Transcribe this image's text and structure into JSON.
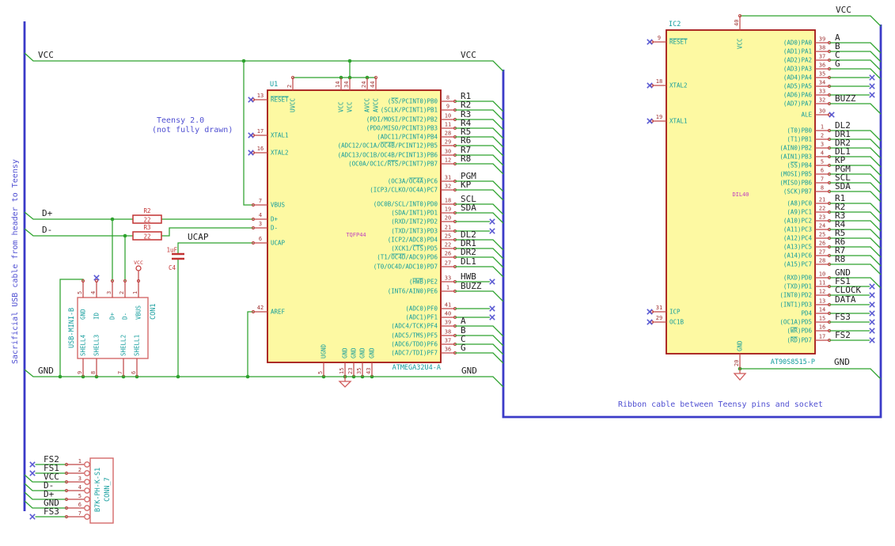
{
  "notes": {
    "sacrificial": "Sacrificial USB cable from header to Teensy",
    "teensy_line1": "Teensy 2.0",
    "teensy_line2": "(not fully drawn)",
    "ribbon": "Ribbon cable between Teensy pins and socket"
  },
  "net_labels": {
    "vcc_top_left": "VCC",
    "vcc_mid": "VCC",
    "vcc_right": "VCC",
    "gnd_left": "GND",
    "gnd_mid": "GND",
    "gnd_right": "GND",
    "dplus": "D+",
    "dminus": "D-",
    "ucap": "UCAP"
  },
  "u1": {
    "ref": "U1",
    "value": "ATMEGA32U4-A",
    "footprint": "TQFP44",
    "left_pins": [
      {
        "num": "13",
        "name": "~RESET~",
        "nc": true
      },
      {
        "num": "17",
        "name": "XTAL1",
        "nc": true
      },
      {
        "num": "16",
        "name": "XTAL2",
        "nc": true
      },
      {
        "num": "7",
        "name": "VBUS"
      },
      {
        "num": "4",
        "name": "D+"
      },
      {
        "num": "3",
        "name": "D-"
      },
      {
        "num": "6",
        "name": "UCAP"
      },
      {
        "num": "42",
        "name": "AREF"
      }
    ],
    "top_pins": [
      {
        "num": "2",
        "name": "UVCC"
      },
      {
        "num": "14",
        "name": "VCC"
      },
      {
        "num": "34",
        "name": "VCC"
      },
      {
        "num": "24",
        "name": "AVCC"
      },
      {
        "num": "44",
        "name": "AVCC"
      }
    ],
    "bottom_pins": [
      {
        "num": "5",
        "name": "UGND"
      },
      {
        "num": "15",
        "name": "GND"
      },
      {
        "num": "23",
        "name": "GND"
      },
      {
        "num": "35",
        "name": "GND"
      },
      {
        "num": "43",
        "name": "GND"
      }
    ],
    "right_pins": [
      {
        "num": "8",
        "name": "(~SS~/PCINT0)PB0",
        "label": "R1",
        "route": "bus"
      },
      {
        "num": "9",
        "name": "(SCLK/PCINT1)PB1",
        "label": "R2",
        "route": "bus"
      },
      {
        "num": "10",
        "name": "(PDI/MOSI/PCINT2)PB2",
        "label": "R3",
        "route": "bus"
      },
      {
        "num": "11",
        "name": "(PDO/MISO/PCINT3)PB3",
        "label": "R4",
        "route": "bus"
      },
      {
        "num": "28",
        "name": "(ADC11/PCINT4)PB4",
        "label": "R5",
        "route": "bus"
      },
      {
        "num": "29",
        "name": "(ADC12/OC1A/~OC4B~/PCINT12)PB5",
        "label": "R6",
        "route": "bus"
      },
      {
        "num": "30",
        "name": "(ADC13/OC1B/OC4B/PCINT13)PB6",
        "label": "R7",
        "route": "bus"
      },
      {
        "num": "12",
        "name": "(OC0A/OC1C/~RTS~/PCINT7)PB7",
        "label": "R8",
        "route": "bus"
      },
      {
        "num": "31",
        "name": "(OC3A/~OC4A~)PC6",
        "label": "PGM",
        "route": "bus"
      },
      {
        "num": "32",
        "name": "(ICP3/CLKO/OC4A)PC7",
        "label": "KP",
        "route": "bus"
      },
      {
        "num": "18",
        "name": "(OC0B/SCL/INT0)PD0",
        "label": "SCL",
        "route": "bus"
      },
      {
        "num": "19",
        "name": "(SDA/INT1)PD1",
        "label": "SDA",
        "route": "bus"
      },
      {
        "num": "20",
        "name": "(RXD/INT2)PD2",
        "label": "",
        "route": "nc"
      },
      {
        "num": "21",
        "name": "(TXD/INT3)PD3",
        "label": "",
        "route": "nc"
      },
      {
        "num": "25",
        "name": "(ICP2/ADC8)PD4",
        "label": "DL2",
        "route": "bus"
      },
      {
        "num": "22",
        "name": "(XCK1/~CTS~)PD5",
        "label": "DR1",
        "route": "bus"
      },
      {
        "num": "26",
        "name": "(T1/~OC4D~/ADC9)PD6",
        "label": "DR2",
        "route": "bus"
      },
      {
        "num": "27",
        "name": "(T0/OC4D/ADC10)PD7",
        "label": "DL1",
        "route": "bus"
      },
      {
        "num": "33",
        "name": "(~HWB~)PE2",
        "label": "HWB",
        "route": "nc"
      },
      {
        "num": "1",
        "name": "(INT6/AIN0)PE6",
        "label": "BUZZ",
        "route": "bus"
      },
      {
        "num": "41",
        "name": "(ADC0)PF0",
        "label": "",
        "route": "nc"
      },
      {
        "num": "40",
        "name": "(ADC1)PF1",
        "label": "",
        "route": "nc"
      },
      {
        "num": "39",
        "name": "(ADC4/TCK)PF4",
        "label": "A",
        "route": "bus"
      },
      {
        "num": "38",
        "name": "(ADC5/TMS)PF5",
        "label": "B",
        "route": "bus"
      },
      {
        "num": "37",
        "name": "(ADC6/TDO)PF6",
        "label": "C",
        "route": "bus"
      },
      {
        "num": "36",
        "name": "(ADC7/TDI)PF7",
        "label": "G",
        "route": "bus"
      }
    ]
  },
  "ic2": {
    "ref": "IC2",
    "value": "AT90S8515-P",
    "footprint": "DIL40",
    "left_pins": [
      {
        "num": "9",
        "name": "~RESET~",
        "nc": true
      },
      {
        "num": "18",
        "name": "XTAL2",
        "nc": true
      },
      {
        "num": "19",
        "name": "XTAL1",
        "nc": true
      },
      {
        "num": "31",
        "name": "ICP",
        "nc": true
      },
      {
        "num": "29",
        "name": "OC1B",
        "nc": true
      }
    ],
    "top_pins": [
      {
        "num": "40",
        "name": "VCC"
      }
    ],
    "bottom_pins": [
      {
        "num": "20",
        "name": "GND"
      }
    ],
    "right_pins": [
      {
        "num": "39",
        "name": "(AD0)PA0",
        "label": "A",
        "route": "bus"
      },
      {
        "num": "38",
        "name": "(AD1)PA1",
        "label": "B",
        "route": "bus"
      },
      {
        "num": "37",
        "name": "(AD2)PA2",
        "label": "C",
        "route": "bus"
      },
      {
        "num": "36",
        "name": "(AD3)PA3",
        "label": "G",
        "route": "bus"
      },
      {
        "num": "35",
        "name": "(AD4)PA4",
        "label": "",
        "route": "nc"
      },
      {
        "num": "34",
        "name": "(AD5)PA5",
        "label": "",
        "route": "nc"
      },
      {
        "num": "33",
        "name": "(AD6)PA6",
        "label": "",
        "route": "nc"
      },
      {
        "num": "32",
        "name": "(AD7)PA7",
        "label": "BUZZ",
        "route": "bus"
      },
      {
        "num": "30",
        "name": "ALE",
        "label": "",
        "route": "stub_nc"
      },
      {
        "num": "1",
        "name": "(T0)PB0",
        "label": "DL2",
        "route": "bus"
      },
      {
        "num": "2",
        "name": "(T1)PB1",
        "label": "DR1",
        "route": "bus"
      },
      {
        "num": "3",
        "name": "(AIN0)PB2",
        "label": "DR2",
        "route": "bus"
      },
      {
        "num": "4",
        "name": "(AIN1)PB3",
        "label": "DL1",
        "route": "bus"
      },
      {
        "num": "5",
        "name": "(~SS~)PB4",
        "label": "KP",
        "route": "bus"
      },
      {
        "num": "6",
        "name": "(MOSI)PB5",
        "label": "PGM",
        "route": "bus"
      },
      {
        "num": "7",
        "name": "(MISO)PB6",
        "label": "SCL",
        "route": "bus"
      },
      {
        "num": "8",
        "name": "(SCK)PB7",
        "label": "SDA",
        "route": "bus"
      },
      {
        "num": "21",
        "name": "(A8)PC0",
        "label": "R1",
        "route": "bus"
      },
      {
        "num": "22",
        "name": "(A9)PC1",
        "label": "R2",
        "route": "bus"
      },
      {
        "num": "23",
        "name": "(A10)PC2",
        "label": "R3",
        "route": "bus"
      },
      {
        "num": "24",
        "name": "(A11)PC3",
        "label": "R4",
        "route": "bus"
      },
      {
        "num": "25",
        "name": "(A12)PC4",
        "label": "R5",
        "route": "bus"
      },
      {
        "num": "26",
        "name": "(A13)PC5",
        "label": "R6",
        "route": "bus"
      },
      {
        "num": "27",
        "name": "(A14)PC6",
        "label": "R7",
        "route": "bus"
      },
      {
        "num": "28",
        "name": "(A15)PC7",
        "label": "R8",
        "route": "bus"
      },
      {
        "num": "10",
        "name": "(RXD)PD0",
        "label": "GND",
        "route": "bus"
      },
      {
        "num": "11",
        "name": "(TXD)PD1",
        "label": "FS1",
        "route": "nc"
      },
      {
        "num": "12",
        "name": "(INT0)PD2",
        "label": "CLOCK",
        "route": "nc"
      },
      {
        "num": "13",
        "name": "(INT1)PD3",
        "label": "DATA",
        "route": "nc"
      },
      {
        "num": "14",
        "name": "PD4",
        "label": "",
        "route": "nc"
      },
      {
        "num": "15",
        "name": "(OC1A)PD5",
        "label": "FS3",
        "route": "nc"
      },
      {
        "num": "16",
        "name": "(~WR~)PD6",
        "label": "",
        "route": "nc"
      },
      {
        "num": "17",
        "name": "(~RD~)PD7",
        "label": "FS2",
        "route": "nc"
      }
    ]
  },
  "con1": {
    "ref": "CON1",
    "value": "USB-MINI-B",
    "top_pins": [
      {
        "num": "5",
        "name": "GND"
      },
      {
        "num": "4",
        "name": "ID",
        "nc": true
      },
      {
        "num": "3",
        "name": "D+"
      },
      {
        "num": "2",
        "name": "D-"
      },
      {
        "num": "1",
        "name": "VBUS"
      }
    ],
    "bottom_pins": [
      {
        "num": "9",
        "name": "SHELL4"
      },
      {
        "num": "8",
        "name": "SHELL3"
      },
      {
        "num": "7",
        "name": "SHELL2"
      },
      {
        "num": "6",
        "name": "SHELL1"
      }
    ]
  },
  "conn7": {
    "ref": "CONN_7",
    "value": "B7K-PH-K-S1",
    "pins": [
      {
        "num": "1",
        "label": "FS2",
        "route": "nc"
      },
      {
        "num": "2",
        "label": "FS1",
        "route": "nc"
      },
      {
        "num": "3",
        "label": "VCC",
        "route": "bus"
      },
      {
        "num": "4",
        "label": "D-",
        "route": "bus"
      },
      {
        "num": "5",
        "label": "D+",
        "route": "bus"
      },
      {
        "num": "6",
        "label": "GND",
        "route": "bus"
      },
      {
        "num": "7",
        "label": "FS3",
        "route": "nc"
      }
    ]
  },
  "r2": {
    "ref": "R2",
    "value": "22"
  },
  "r3": {
    "ref": "R3",
    "value": "22"
  },
  "c4": {
    "ref": "C4",
    "value": "1uF"
  },
  "usb_power_flag": "VCC",
  "colors": {
    "wire": "#2da22d",
    "bus": "#3b3bc8",
    "body_fill": "#fdf9a2",
    "body_stroke": "#a31515",
    "pin": "#c04848",
    "pin_number": "#9e3030",
    "pin_name": "#129c9c",
    "net_label": "#222222",
    "no_connect": "#5858d2",
    "note": "#5050d2",
    "field_red": "#c23232",
    "footprint": "#c040c0",
    "connector": "#d46a6a"
  }
}
